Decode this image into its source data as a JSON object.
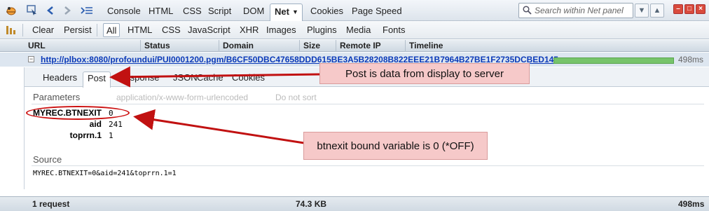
{
  "toolbar": {
    "tabs": [
      "Console",
      "HTML",
      "CSS",
      "Script",
      "DOM",
      "Net",
      "Cookies",
      "Page Speed"
    ],
    "active_tab": "Net",
    "search_placeholder": "Search within Net panel"
  },
  "filters": {
    "clear": "Clear",
    "persist": "Persist",
    "items": [
      "All",
      "HTML",
      "CSS",
      "JavaScript",
      "XHR",
      "Images",
      "Plugins",
      "Media",
      "Fonts"
    ],
    "active": "All"
  },
  "columns": [
    "URL",
    "Status",
    "Domain",
    "Size",
    "Remote IP",
    "Timeline"
  ],
  "request": {
    "url": "http://plbox:8080/profoundui/PUI0001200.pgm/B6CF50DBC47658DDD615BE3A5B28208B822EEE21B7964B27BE1F2735DCBED145",
    "time": "498ms"
  },
  "detail_tabs": [
    "Headers",
    "Post",
    "Response",
    "JSON",
    "Cache",
    "Cookies"
  ],
  "detail_active": "Post",
  "parameters": {
    "title": "Parameters",
    "content_type": "application/x-www-form-urlencoded",
    "sort_label": "Do not sort",
    "rows": [
      {
        "name": "MYREC.BTNEXIT",
        "value": "0"
      },
      {
        "name": "aid",
        "value": "241"
      },
      {
        "name": "toprrn.1",
        "value": "1"
      }
    ]
  },
  "source": {
    "title": "Source",
    "text": "MYREC.BTNEXIT=0&aid=241&toprrn.1=1"
  },
  "status_bar": {
    "requests": "1 request",
    "size": "74.3 KB",
    "time": "498ms"
  },
  "annotations": {
    "post_note": "Post is data from display to server",
    "btnexit_note": "btnexit bound variable is 0 (*OFF)"
  },
  "colors": {
    "annotation_fill": "#f6c9c9",
    "annotation_arrow": "#c11111",
    "link": "#0b3ab8",
    "timeline_bar": "#77c46b"
  }
}
